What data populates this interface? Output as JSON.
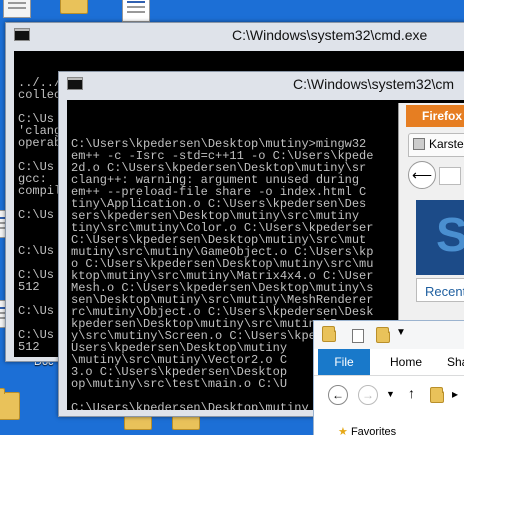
{
  "desktop": {
    "doc_label": "Doc"
  },
  "cmd_back": {
    "title": "C:\\Windows\\system32\\cmd.exe",
    "lines": [
      "../../i686-w64-mingw32/bin/ld.exe: final link failed: In",
      "collect2.exe: error: ld returned 1 exit status",
      "",
      "C:\\Us",
      "'clang",
      "operab",
      "",
      "C:\\Us",
      "gcc:",
      "compil",
      "",
      "C:\\Us",
      "",
      "",
      "C:\\Us",
      "",
      "C:\\Us",
      "512",
      "",
      "C:\\Us",
      "",
      "C:\\Us",
      "512",
      "",
      "C:\\Us"
    ]
  },
  "cmd_front": {
    "title": "C:\\Windows\\system32\\cm",
    "lines": [
      "",
      "C:\\Users\\kpedersen\\Desktop\\mutiny>mingw32",
      "em++ -c -Isrc -std=c++11 -o C:\\Users\\kpede",
      "2d.o C:\\Users\\kpedersen\\Desktop\\mutiny\\sr",
      "clang++: warning: argument unused during",
      "em++ --preload-file share -o index.html C",
      "tiny\\Application.o C:\\Users\\kpedersen\\Des",
      "sers\\kpedersen\\Desktop\\mutiny\\src\\mutiny",
      "tiny\\src\\mutiny\\Color.o C:\\Users\\kpederser",
      "C:\\Users\\kpedersen\\Desktop\\mutiny\\src\\mut",
      "mutiny\\src\\mutiny\\GameObject.o C:\\Users\\kp",
      "o C:\\Users\\kpedersen\\Desktop\\mutiny\\src\\mu",
      "ktop\\mutiny\\src\\mutiny\\Matrix4x4.o C:\\User",
      "Mesh.o C:\\Users\\kpedersen\\Desktop\\mutiny\\s",
      "sen\\Desktop\\mutiny\\src\\mutiny\\MeshRenderer",
      "rc\\mutiny\\Object.o C:\\Users\\kpedersen\\Desk",
      "kpedersen\\Desktop\\mutiny\\src\\mutiny\\Resou",
      "y\\src\\mutiny\\Screen.o C:\\Users\\kpedersen\\",
      "Users\\kpedersen\\Desktop\\mutiny",
      "\\mutiny\\src\\mutiny\\Vector2.o C",
      "3.o C:\\Users\\kpedersen\\Desktop",
      "op\\mutiny\\src\\test\\main.o C:\\U",
      "",
      "C:\\Users\\kpedersen\\Desktop\\mutiny"
    ]
  },
  "firefox": {
    "tab_label": "Firefox",
    "page_tab": "Karste",
    "recent_label": "Recent"
  },
  "explorer": {
    "ribbon_tabs": [
      "File",
      "Home",
      "Sha"
    ],
    "favorites": "Favorites"
  },
  "colors": {
    "desktop_bg": "#1c6fd6",
    "firefox_orange": "#e67e22",
    "file_tab_blue": "#1979ca"
  }
}
